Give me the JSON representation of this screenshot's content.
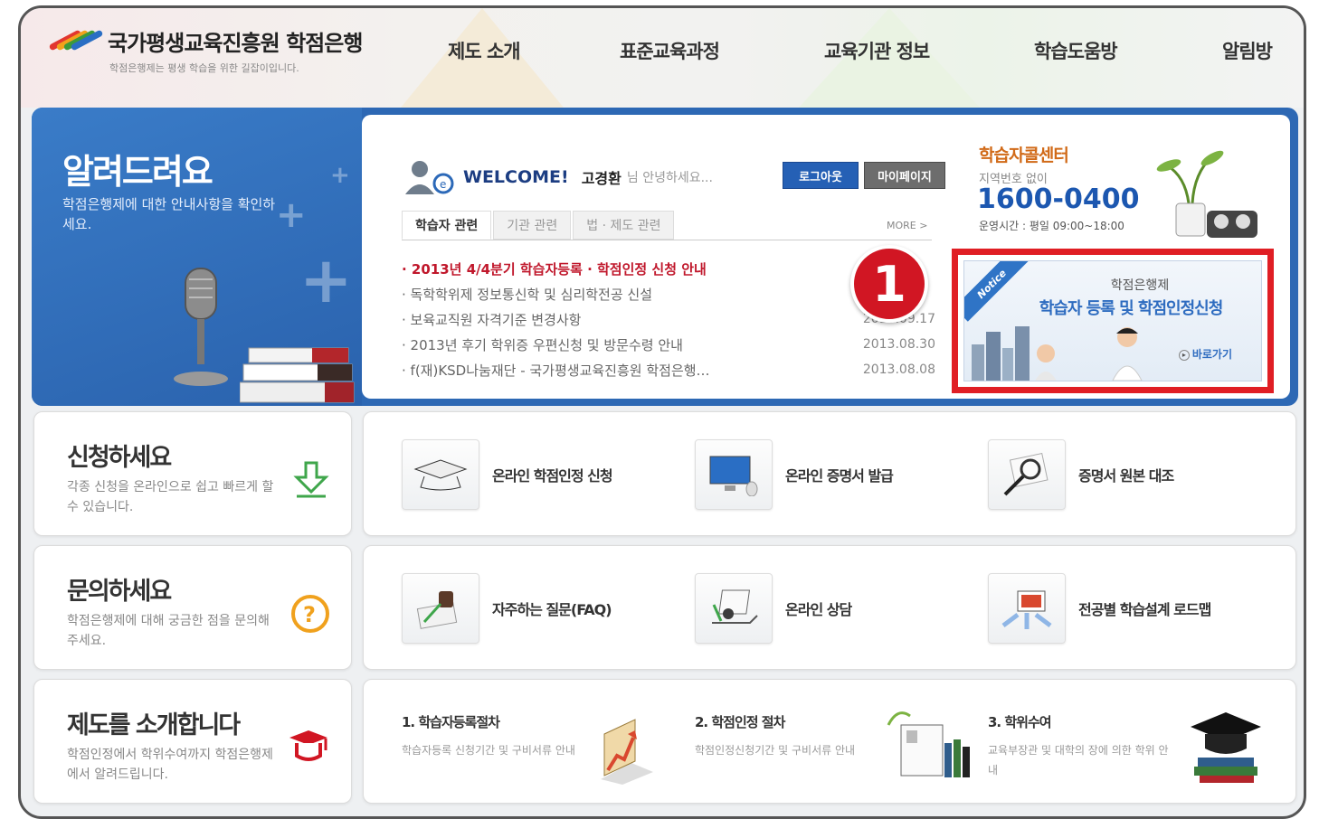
{
  "header": {
    "logo_title": "국가평생교육진흥원 학점은행",
    "logo_sub": "학점은행제는 평생 학습을 위한 길잡이입니다.",
    "nav": [
      "제도 소개",
      "표준교육과정",
      "교육기관 정보",
      "학습도움방",
      "알림방"
    ]
  },
  "notice": {
    "title": "알려드려요",
    "desc": "학점은행제에 대한 안내사항을 확인하세요."
  },
  "welcome": {
    "label": "WELCOME!",
    "user": "고경환",
    "greeting": "님 안녕하세요...",
    "logout": "로그아웃",
    "mypage": "마이페이지"
  },
  "tabs": [
    "학습자 관련",
    "기관 관련",
    "법 · 제도 관련"
  ],
  "more": "MORE >",
  "news": [
    {
      "title": "· 2013년 4/4분기 학습자등록 · 학점인정 신청 안내",
      "date": "",
      "hot": true
    },
    {
      "title": "· 독학학위제 정보통신학 및 심리학전공 신설",
      "date": ""
    },
    {
      "title": "· 보육교직원 자격기준 변경사항",
      "date": "2013.09.17"
    },
    {
      "title": "· 2013년 후기 학위증 우편신청 및 방문수령 안내",
      "date": "2013.08.30"
    },
    {
      "title": "· f(재)KSD나눔재단 - 국가평생교육진흥원 학점은행…",
      "date": "2013.08.08"
    }
  ],
  "callout_number": "1",
  "center": {
    "title": "학습자콜센터",
    "sub": "지역번호 없이",
    "phone": "1600-0400",
    "hours": "운영시간 : 평일 09:00~18:00"
  },
  "banner": {
    "ribbon": "Notice",
    "small": "학점은행제",
    "big": "학습자 등록 및 학점인정신청",
    "go": "바로가기"
  },
  "rows": [
    {
      "title": "신청하세요",
      "desc": "각종 신청을 온라인으로 쉽고 빠르게 할 수 있습니다.",
      "services": [
        "온라인 학점인정 신청",
        "온라인 증명서 발급",
        "증명서 원본 대조"
      ]
    },
    {
      "title": "문의하세요",
      "desc": "학점은행제에 대해 궁금한 점을 문의해주세요.",
      "services": [
        "자주하는 질문(FAQ)",
        "온라인 상담",
        "전공별 학습설계 로드맵"
      ]
    },
    {
      "title": "제도를 소개합니다",
      "desc": "학점인정에서 학위수여까지 학점은행제에서 알려드립니다.",
      "procs": [
        {
          "title": "1. 학습자등록절차",
          "desc": "학습자등록 신청기간 및 구비서류 안내"
        },
        {
          "title": "2. 학점인정 절차",
          "desc": "학점인정신청기간 및 구비서류 안내"
        },
        {
          "title": "3. 학위수여",
          "desc": "교육부장관 및 대학의 장에 의한 학위 안내"
        }
      ]
    }
  ],
  "colors": {
    "accent_blue": "#2d68b4",
    "highlight_red": "#e01e24",
    "hot_red": "#c0172b",
    "phone_blue": "#1c57b0",
    "center_orange": "#d16a18"
  }
}
